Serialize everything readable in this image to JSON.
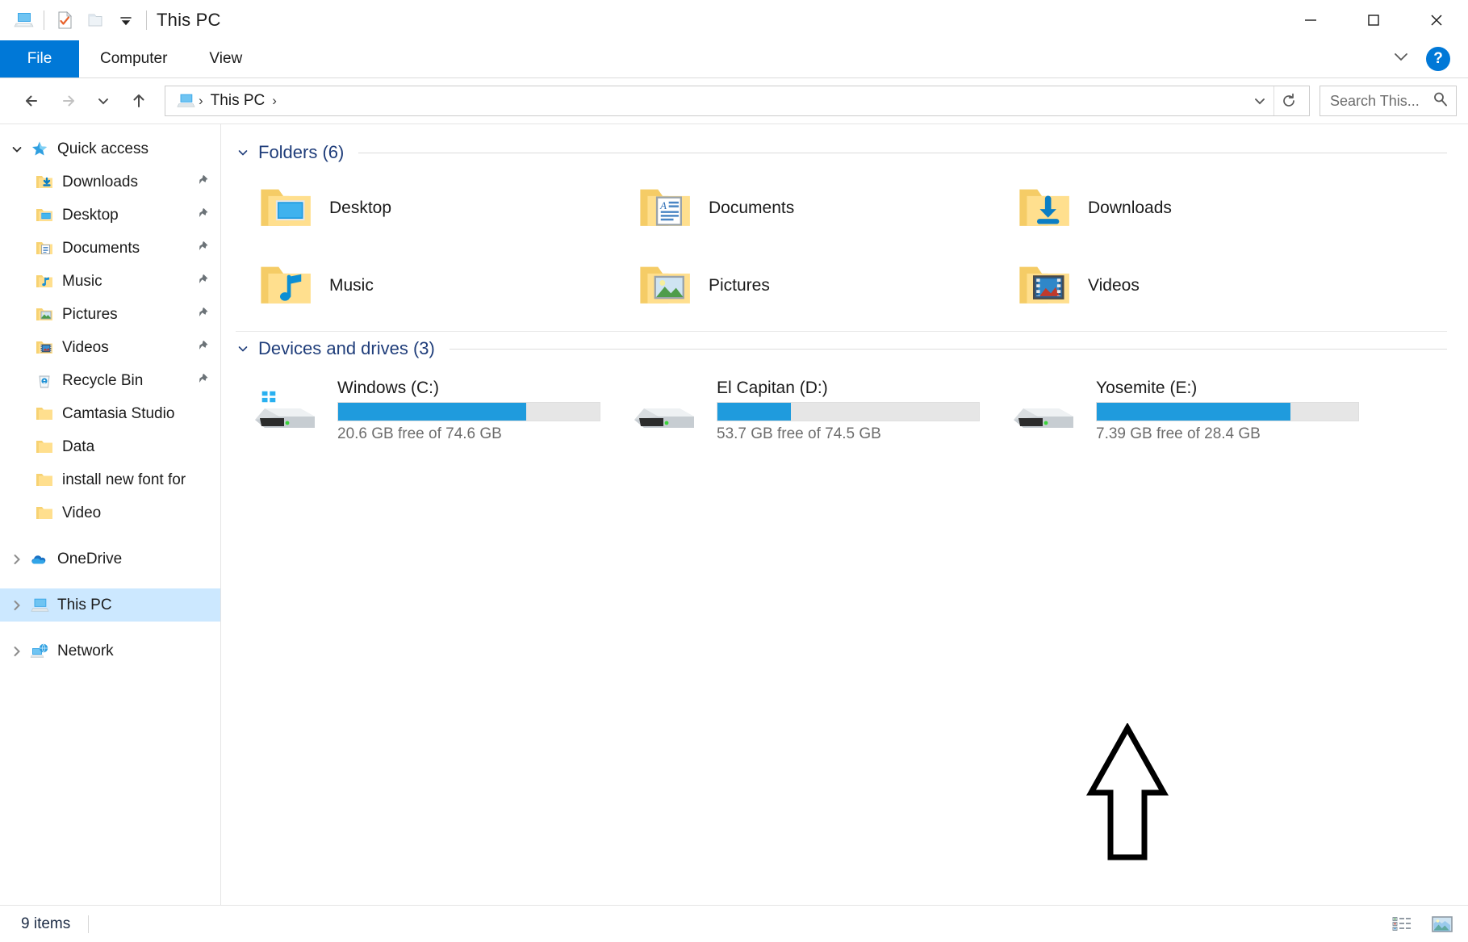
{
  "window": {
    "title": "This PC",
    "quick_access_toolbar": [
      "this-pc-icon",
      "properties-icon",
      "new-folder-icon",
      "customize-dropdown-icon"
    ],
    "controls": {
      "minimize": "minimize-icon",
      "maximize": "maximize-icon",
      "close": "close-icon"
    }
  },
  "ribbon": {
    "tabs": [
      {
        "label": "File",
        "active": true
      },
      {
        "label": "Computer",
        "active": false
      },
      {
        "label": "View",
        "active": false
      }
    ],
    "collapse_icon": "chevron-down-icon",
    "help_label": "?"
  },
  "address_bar": {
    "back_icon": "back-arrow-icon",
    "forward_icon": "forward-arrow-icon",
    "recent_icon": "chevron-down-icon",
    "up_icon": "up-arrow-icon",
    "breadcrumb_icon": "this-pc-icon",
    "breadcrumbs": [
      "This PC"
    ],
    "separator": "›",
    "dropdown_icon": "chevron-down-icon",
    "refresh_icon": "refresh-icon"
  },
  "search": {
    "placeholder": "Search This...",
    "icon": "search-icon"
  },
  "sidebar": {
    "items": [
      {
        "label": "Quick access",
        "icon": "star-pin-icon",
        "chevron": "expanded",
        "level": 0,
        "pinned": false,
        "selected": false
      },
      {
        "label": "Downloads",
        "icon": "folder-downloads-icon",
        "chevron": "none",
        "level": 1,
        "pinned": true,
        "selected": false
      },
      {
        "label": "Desktop",
        "icon": "folder-desktop-icon",
        "chevron": "none",
        "level": 1,
        "pinned": true,
        "selected": false
      },
      {
        "label": "Documents",
        "icon": "folder-documents-icon",
        "chevron": "none",
        "level": 1,
        "pinned": true,
        "selected": false
      },
      {
        "label": "Music",
        "icon": "folder-music-icon",
        "chevron": "none",
        "level": 1,
        "pinned": true,
        "selected": false
      },
      {
        "label": "Pictures",
        "icon": "folder-pictures-icon",
        "chevron": "none",
        "level": 1,
        "pinned": true,
        "selected": false
      },
      {
        "label": "Videos",
        "icon": "folder-videos-icon",
        "chevron": "none",
        "level": 1,
        "pinned": true,
        "selected": false
      },
      {
        "label": "Recycle Bin",
        "icon": "recycle-bin-icon",
        "chevron": "none",
        "level": 1,
        "pinned": true,
        "selected": false
      },
      {
        "label": "Camtasia Studio",
        "icon": "folder-icon",
        "chevron": "none",
        "level": 1,
        "pinned": false,
        "selected": false
      },
      {
        "label": "Data",
        "icon": "folder-icon",
        "chevron": "none",
        "level": 1,
        "pinned": false,
        "selected": false
      },
      {
        "label": "install new font for",
        "icon": "folder-icon",
        "chevron": "none",
        "level": 1,
        "pinned": false,
        "selected": false
      },
      {
        "label": "Video",
        "icon": "folder-icon",
        "chevron": "none",
        "level": 1,
        "pinned": false,
        "selected": false
      },
      {
        "label": "OneDrive",
        "icon": "onedrive-cloud-icon",
        "chevron": "collapsed",
        "level": 0,
        "pinned": false,
        "selected": false
      },
      {
        "label": "This PC",
        "icon": "this-pc-icon",
        "chevron": "collapsed",
        "level": 0,
        "pinned": false,
        "selected": true
      },
      {
        "label": "Network",
        "icon": "network-icon",
        "chevron": "collapsed",
        "level": 0,
        "pinned": false,
        "selected": false
      }
    ]
  },
  "main": {
    "groups": [
      {
        "title": "Folders (6)",
        "chevron": "expanded",
        "items": [
          {
            "label": "Desktop",
            "icon": "folder-desktop-icon"
          },
          {
            "label": "Documents",
            "icon": "folder-documents-icon"
          },
          {
            "label": "Downloads",
            "icon": "folder-downloads-icon"
          },
          {
            "label": "Music",
            "icon": "folder-music-icon"
          },
          {
            "label": "Pictures",
            "icon": "folder-pictures-icon"
          },
          {
            "label": "Videos",
            "icon": "folder-videos-icon"
          }
        ]
      }
    ],
    "drives_group": {
      "title": "Devices and drives (3)",
      "chevron": "expanded",
      "drives": [
        {
          "name": "Windows (C:)",
          "icon": "windows-drive-icon",
          "free_text": "20.6 GB free of 74.6 GB",
          "free_gb": 20.6,
          "total_gb": 74.6,
          "used_percent": 72
        },
        {
          "name": "El Capitan (D:)",
          "icon": "hard-drive-icon",
          "free_text": "53.7 GB free of 74.5 GB",
          "free_gb": 53.7,
          "total_gb": 74.5,
          "used_percent": 28
        },
        {
          "name": "Yosemite (E:)",
          "icon": "hard-drive-icon",
          "free_text": "7.39 GB free of 28.4 GB",
          "free_gb": 7.39,
          "total_gb": 28.4,
          "used_percent": 74
        }
      ]
    }
  },
  "statusbar": {
    "item_count": "9 items",
    "view_buttons": [
      {
        "icon": "details-view-icon",
        "active": true
      },
      {
        "icon": "large-icons-view-icon",
        "active": false
      }
    ]
  },
  "annotation": {
    "arrow": "up-arrow-annotation",
    "points_at": "El Capitan (D:)"
  },
  "colors": {
    "accent": "#0078d7",
    "drive_bar": "#1f9bdd",
    "group_title": "#1f3d7a",
    "selection": "#cce8ff"
  }
}
